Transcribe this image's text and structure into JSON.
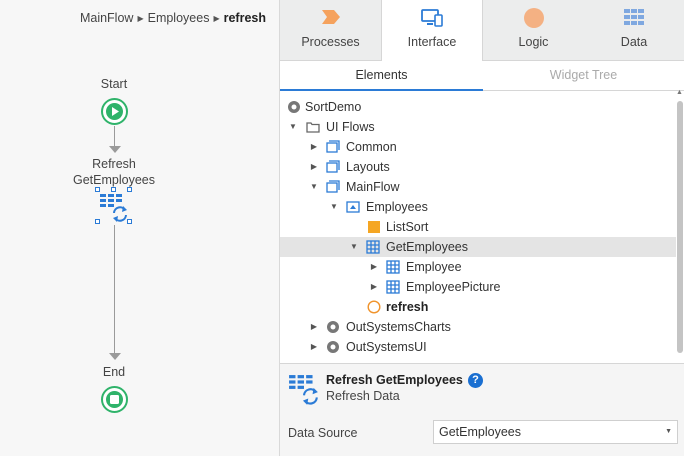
{
  "breadcrumb": {
    "items": [
      "MainFlow",
      "Employees"
    ],
    "current": "refresh"
  },
  "flow": {
    "start_label": "Start",
    "action_label_line1": "Refresh",
    "action_label_line2": "GetEmployees",
    "end_label": "End"
  },
  "main_tabs": [
    {
      "label": "Processes",
      "icon": "process-chevron-icon"
    },
    {
      "label": "Interface",
      "icon": "monitor-icon",
      "active": true
    },
    {
      "label": "Logic",
      "icon": "logic-circle-icon"
    },
    {
      "label": "Data",
      "icon": "data-grid-icon"
    }
  ],
  "sub_tabs": {
    "elements": "Elements",
    "widget_tree": "Widget Tree"
  },
  "tree": [
    {
      "label": "SortDemo",
      "icon": "module-icon",
      "depth": 0,
      "expanded": null
    },
    {
      "label": "UI Flows",
      "icon": "folder-icon",
      "depth": 0,
      "expanded": true
    },
    {
      "label": "Common",
      "icon": "flow-icon",
      "depth": 1,
      "expanded": false
    },
    {
      "label": "Layouts",
      "icon": "flow-icon",
      "depth": 1,
      "expanded": false
    },
    {
      "label": "MainFlow",
      "icon": "flow-icon",
      "depth": 1,
      "expanded": true
    },
    {
      "label": "Employees",
      "icon": "screen-icon",
      "depth": 2,
      "expanded": true
    },
    {
      "label": "ListSort",
      "icon": "widget-icon",
      "depth": 3,
      "expanded": null
    },
    {
      "label": "GetEmployees",
      "icon": "aggregate-icon",
      "depth": 3,
      "expanded": true,
      "selected": true
    },
    {
      "label": "Employee",
      "icon": "entity-icon",
      "depth": 4,
      "expanded": false
    },
    {
      "label": "EmployeePicture",
      "icon": "entity-icon",
      "depth": 4,
      "expanded": false
    },
    {
      "label": "refresh",
      "icon": "action-circle-icon",
      "depth": 3,
      "expanded": null,
      "bold": true
    },
    {
      "label": "OutSystemsCharts",
      "icon": "module-icon",
      "depth": 1,
      "expanded": false
    },
    {
      "label": "OutSystemsUI",
      "icon": "module-icon",
      "depth": 1,
      "expanded": false
    }
  ],
  "properties": {
    "title": "Refresh GetEmployees",
    "subtitle": "Refresh Data",
    "data_source_label": "Data Source",
    "data_source_value": "GetEmployees"
  },
  "colors": {
    "accent_blue": "#2b7bd6",
    "start_green": "#2fb36a",
    "process_orange": "#f5a25d",
    "logic_orange": "#f4b183",
    "selection_grey": "#e4e4e4"
  }
}
